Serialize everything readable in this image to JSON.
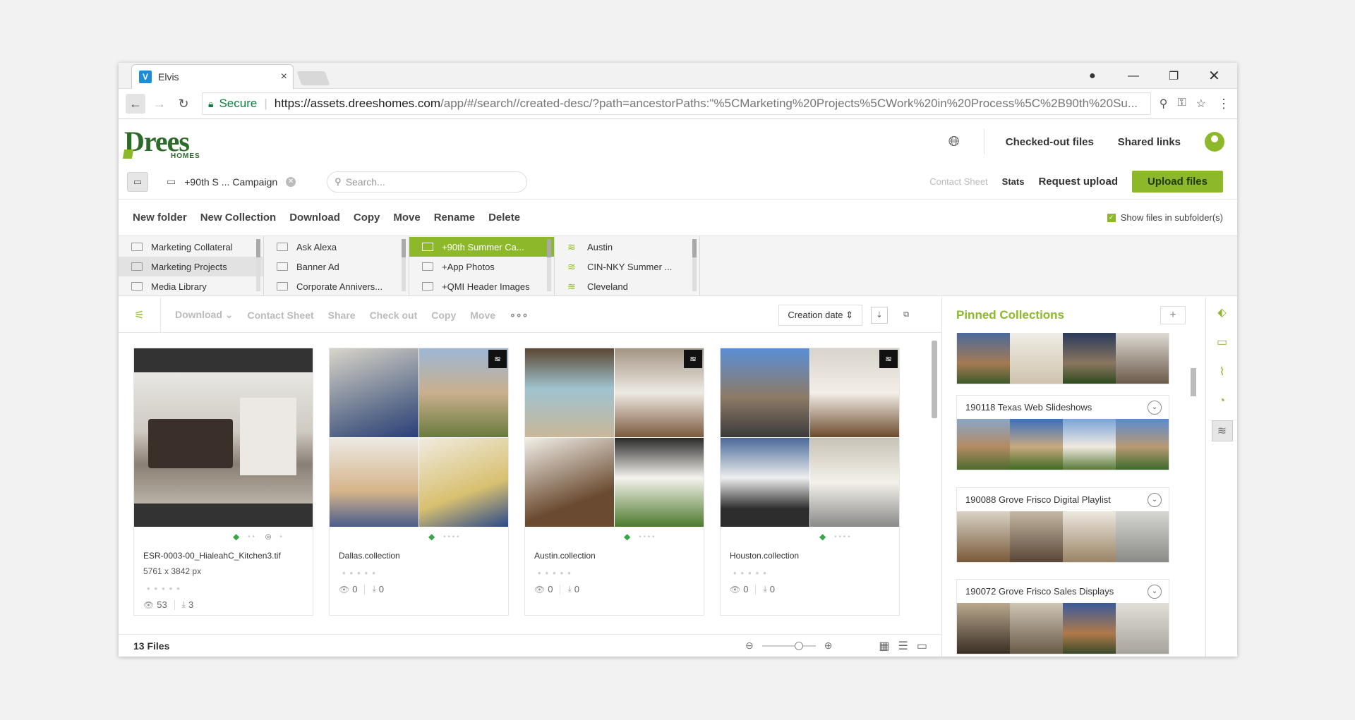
{
  "browser": {
    "tab_title": "Elvis",
    "favicon_letter": "V",
    "secure_label": "Secure",
    "url_domain": "https://assets.dreeshomes.com",
    "url_path": "/app/#/search//created-desc/?path=ancestorPaths:\"%5CMarketing%20Projects%5CWork%20in%20Process%5C%2B90th%20Su...",
    "icons": [
      "back-icon",
      "forward-icon",
      "reload-icon",
      "lock-icon",
      "zoom-icon",
      "key-icon",
      "star-icon",
      "menu-icon",
      "profile-icon",
      "minimize-icon",
      "restore-icon",
      "close-icon"
    ]
  },
  "header": {
    "logo_word": "Drees",
    "logo_sub": "HOMES",
    "links": [
      "Checked-out files",
      "Shared links"
    ]
  },
  "toolbar": {
    "breadcrumb": "+90th S ... Campaign",
    "search_placeholder": "Search...",
    "contact_sheet": "Contact Sheet",
    "stats": "Stats",
    "request_upload": "Request upload",
    "upload_files": "Upload files"
  },
  "actions": [
    "New folder",
    "New Collection",
    "Download",
    "Copy",
    "Move",
    "Rename",
    "Delete"
  ],
  "show_subfolders": "Show files in subfolder(s)",
  "folders": {
    "col1": [
      "Marketing Collateral",
      "Marketing Projects",
      "Media Library"
    ],
    "col2": [
      "Ask Alexa",
      "Banner Ad",
      "Corporate Annivers..."
    ],
    "col3": [
      "+90th Summer Ca...",
      "+App Photos",
      "+QMI Header Images"
    ],
    "col4": [
      "Austin",
      "CIN-NKY Summer ...",
      "Cleveland"
    ]
  },
  "filebar": {
    "actions": [
      "Download",
      "Contact Sheet",
      "Share",
      "Check out",
      "Copy",
      "Move"
    ],
    "more": "∘∘∘",
    "sort": "Creation date"
  },
  "files": [
    {
      "name": "ESR-0003-00_HialeahC_Kitchen3.tif",
      "dims": "5761 x 3842 px",
      "views": "53",
      "downloads": "3"
    },
    {
      "name": "Dallas.collection",
      "dims": "",
      "views": "0",
      "downloads": "0"
    },
    {
      "name": "Austin.collection",
      "dims": "",
      "views": "0",
      "downloads": "0"
    },
    {
      "name": "Houston.collection",
      "dims": "",
      "views": "0",
      "downloads": "0"
    }
  ],
  "status": {
    "file_count": "13 Files"
  },
  "pinned": {
    "title": "Pinned Collections",
    "add": "+",
    "collections": [
      {
        "name": "190118 Texas Web Slideshows"
      },
      {
        "name": "190088 Grove Frisco Digital Playlist"
      },
      {
        "name": "190072 Grove Frisco Sales Displays"
      }
    ]
  },
  "colors": {
    "accent": "#8db82a",
    "brand_green": "#2d6b2a",
    "tag_green": "#3aa54a"
  }
}
